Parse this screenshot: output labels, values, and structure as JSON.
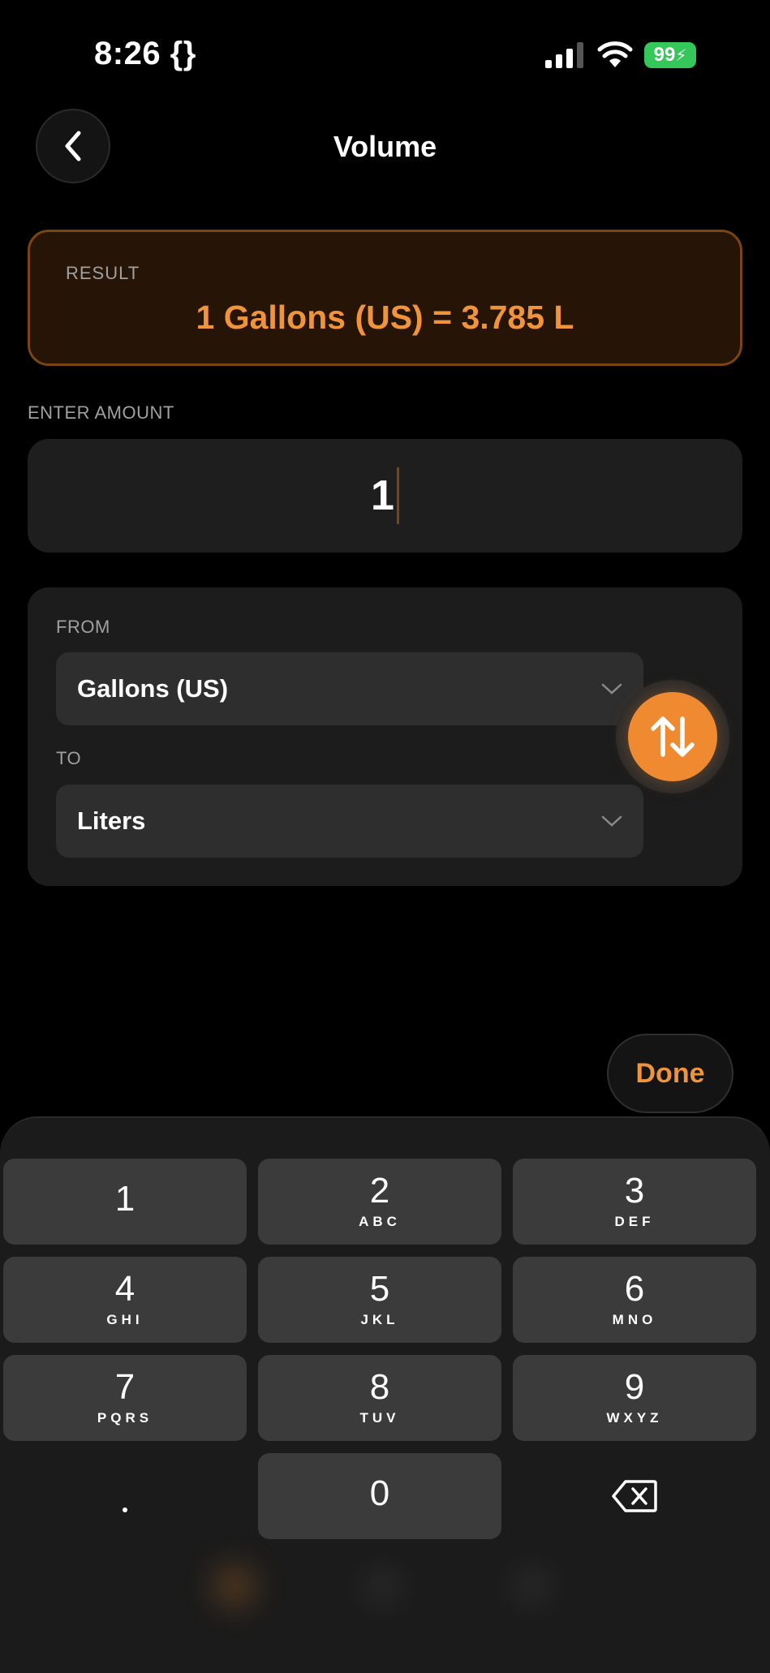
{
  "status_bar": {
    "time": "8:26 {}",
    "battery": "99"
  },
  "nav": {
    "title": "Volume",
    "back_icon": "chevron-left-icon"
  },
  "result": {
    "label": "RESULT",
    "text": "1 Gallons (US) = 3.785 L"
  },
  "amount": {
    "label": "ENTER AMOUNT",
    "value": "1"
  },
  "units": {
    "from_label": "FROM",
    "from_value": "Gallons (US)",
    "to_label": "TO",
    "to_value": "Liters",
    "swap_icon": "swap-arrows-icon"
  },
  "done_label": "Done",
  "keyboard": {
    "keys": [
      {
        "digit": "1",
        "letters": ""
      },
      {
        "digit": "2",
        "letters": "ABC"
      },
      {
        "digit": "3",
        "letters": "DEF"
      },
      {
        "digit": "4",
        "letters": "GHI"
      },
      {
        "digit": "5",
        "letters": "JKL"
      },
      {
        "digit": "6",
        "letters": "MNO"
      },
      {
        "digit": "7",
        "letters": "PQRS"
      },
      {
        "digit": "8",
        "letters": "TUV"
      },
      {
        "digit": "9",
        "letters": "WXYZ"
      },
      {
        "digit": "0",
        "letters": ""
      }
    ],
    "decimal": ".",
    "delete_icon": "backspace-icon"
  },
  "colors": {
    "accent": "#ef8a30",
    "result_bg": "#261506",
    "battery": "#34c759"
  }
}
